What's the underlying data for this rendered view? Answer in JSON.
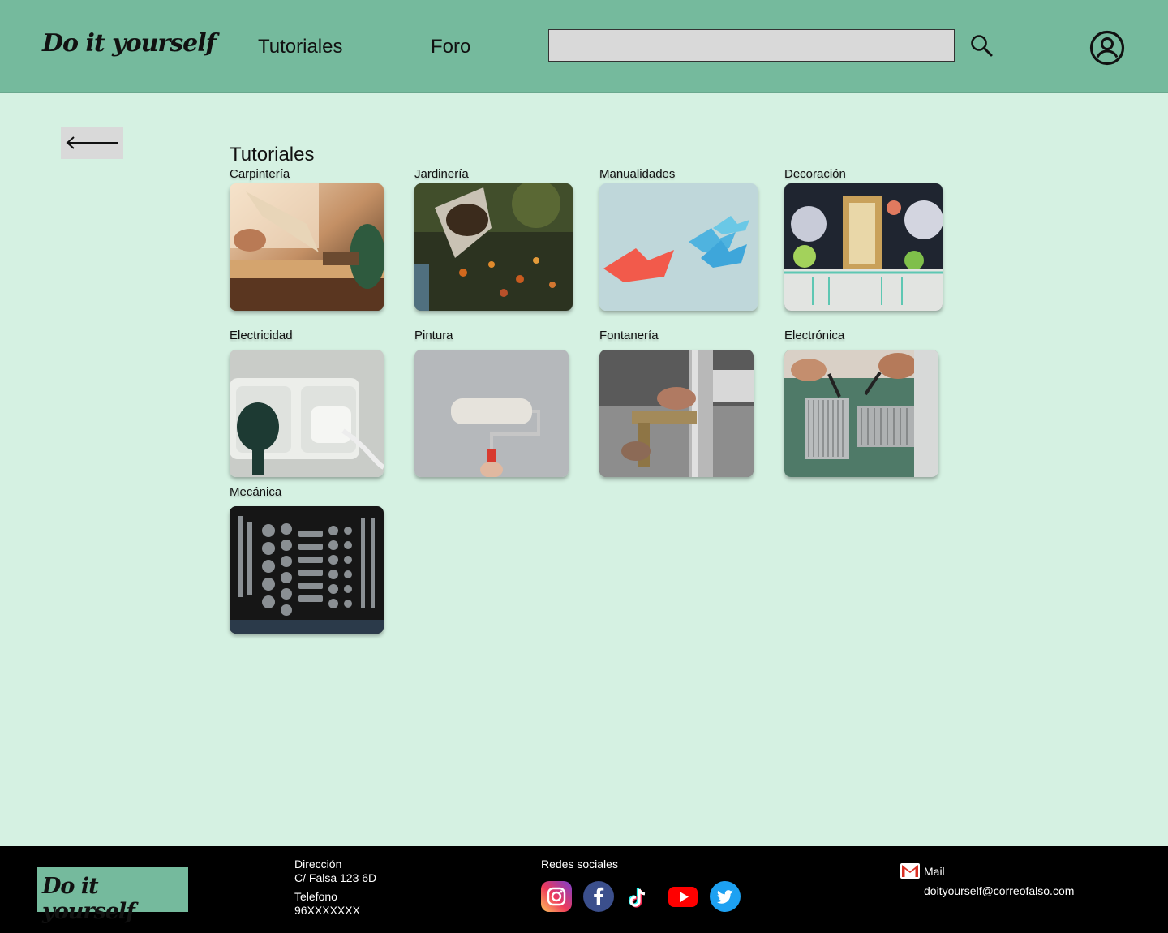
{
  "header": {
    "logo": "Do it yourself",
    "nav": {
      "tutoriales": "Tutoriales",
      "foro": "Foro"
    },
    "search": {
      "value": "",
      "placeholder": ""
    }
  },
  "main": {
    "title": "Tutoriales",
    "categories": [
      {
        "label": "Carpintería"
      },
      {
        "label": "Jardinería"
      },
      {
        "label": "Manualidades"
      },
      {
        "label": "Decoración"
      },
      {
        "label": "Electricidad"
      },
      {
        "label": "Pintura"
      },
      {
        "label": "Fontanería"
      },
      {
        "label": "Electrónica"
      },
      {
        "label": "Mecánica"
      }
    ]
  },
  "footer": {
    "logo": "Do it yourself",
    "address_label": "Dirección",
    "address": "C/ Falsa 123 6D",
    "phone_label": "Telefono",
    "phone": "96XXXXXXX",
    "social_label": "Redes sociales",
    "social_icons": [
      "instagram-icon",
      "facebook-icon",
      "tiktok-icon",
      "youtube-icon",
      "twitter-icon"
    ],
    "mail_label": "Mail",
    "mail": "doityourself@correofalso.com"
  },
  "colors": {
    "header_bg": "#75ba9d",
    "page_bg": "#d5f1e2",
    "footer_bg": "#000000",
    "search_bg": "#d9d9d9"
  }
}
